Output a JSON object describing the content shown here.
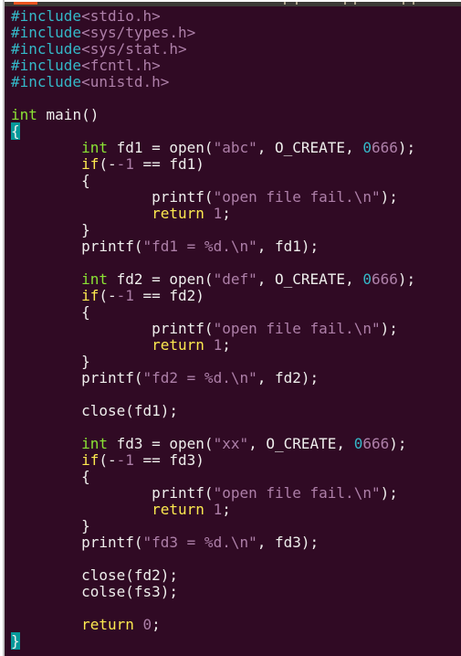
{
  "colors": {
    "background": "#300a24",
    "preprocessor": "#34b8c8",
    "type": "#8ae234",
    "keyword": "#fce94f",
    "string": "#ad7fa8",
    "cursor": "#06989a",
    "tab_accent": "#e95420"
  },
  "editor": {
    "lines": [
      [
        [
          "#include",
          "preproc"
        ],
        [
          "<stdio.h>",
          "include"
        ]
      ],
      [
        [
          "#include",
          "preproc"
        ],
        [
          "<sys/types.h>",
          "include"
        ]
      ],
      [
        [
          "#include",
          "preproc"
        ],
        [
          "<sys/stat.h>",
          "include"
        ]
      ],
      [
        [
          "#include",
          "preproc"
        ],
        [
          "<fcntl.h>",
          "include"
        ]
      ],
      [
        [
          "#include",
          "preproc"
        ],
        [
          "<unistd.h>",
          "include"
        ]
      ],
      [],
      [
        [
          "int",
          "type"
        ],
        [
          " main()",
          "normal"
        ]
      ],
      [
        [
          "{",
          "cursor"
        ]
      ],
      [
        [
          "\t",
          "normal"
        ],
        [
          "int",
          "type"
        ],
        [
          " fd1 = open(",
          "normal"
        ],
        [
          "\"abc\"",
          "string"
        ],
        [
          ", O_CREATE, ",
          "normal"
        ],
        [
          "0",
          "octal"
        ],
        [
          "666",
          "number"
        ],
        [
          ");",
          "normal"
        ]
      ],
      [
        [
          "\t",
          "normal"
        ],
        [
          "if",
          "keyword"
        ],
        [
          "(-",
          "normal"
        ],
        [
          "-1",
          "number"
        ],
        [
          " == fd1)",
          "normal"
        ]
      ],
      [
        [
          "\t{",
          "normal"
        ]
      ],
      [
        [
          "\t\tprintf(",
          "normal"
        ],
        [
          "\"open file fail.\\n\"",
          "string"
        ],
        [
          ");",
          "normal"
        ]
      ],
      [
        [
          "\t\t",
          "normal"
        ],
        [
          "return",
          "keyword"
        ],
        [
          " ",
          "normal"
        ],
        [
          "1",
          "number"
        ],
        [
          ";",
          "normal"
        ]
      ],
      [
        [
          "\t}",
          "normal"
        ]
      ],
      [
        [
          "\tprintf(",
          "normal"
        ],
        [
          "\"fd1 = %d.\\n\"",
          "string"
        ],
        [
          ", fd1);",
          "normal"
        ]
      ],
      [],
      [
        [
          "\t",
          "normal"
        ],
        [
          "int",
          "type"
        ],
        [
          " fd2 = open(",
          "normal"
        ],
        [
          "\"def\"",
          "string"
        ],
        [
          ", O_CREATE, ",
          "normal"
        ],
        [
          "0",
          "octal"
        ],
        [
          "666",
          "number"
        ],
        [
          ");",
          "normal"
        ]
      ],
      [
        [
          "\t",
          "normal"
        ],
        [
          "if",
          "keyword"
        ],
        [
          "(-",
          "normal"
        ],
        [
          "-1",
          "number"
        ],
        [
          " == fd2)",
          "normal"
        ]
      ],
      [
        [
          "\t{",
          "normal"
        ]
      ],
      [
        [
          "\t\tprintf(",
          "normal"
        ],
        [
          "\"open file fail.\\n\"",
          "string"
        ],
        [
          ");",
          "normal"
        ]
      ],
      [
        [
          "\t\t",
          "normal"
        ],
        [
          "return",
          "keyword"
        ],
        [
          " ",
          "normal"
        ],
        [
          "1",
          "number"
        ],
        [
          ";",
          "normal"
        ]
      ],
      [
        [
          "\t}",
          "normal"
        ]
      ],
      [
        [
          "\tprintf(",
          "normal"
        ],
        [
          "\"fd2 = %d.\\n\"",
          "string"
        ],
        [
          ", fd2);",
          "normal"
        ]
      ],
      [],
      [
        [
          "\tclose(fd1);",
          "normal"
        ]
      ],
      [],
      [
        [
          "\t",
          "normal"
        ],
        [
          "int",
          "type"
        ],
        [
          " fd3 = open(",
          "normal"
        ],
        [
          "\"xx\"",
          "string"
        ],
        [
          ", O_CREATE, ",
          "normal"
        ],
        [
          "0",
          "octal"
        ],
        [
          "666",
          "number"
        ],
        [
          ");",
          "normal"
        ]
      ],
      [
        [
          "\t",
          "normal"
        ],
        [
          "if",
          "keyword"
        ],
        [
          "(-",
          "normal"
        ],
        [
          "-1",
          "number"
        ],
        [
          " == fd3)",
          "normal"
        ]
      ],
      [
        [
          "\t{",
          "normal"
        ]
      ],
      [
        [
          "\t\tprintf(",
          "normal"
        ],
        [
          "\"open file fail.\\n\"",
          "string"
        ],
        [
          ");",
          "normal"
        ]
      ],
      [
        [
          "\t\t",
          "normal"
        ],
        [
          "return",
          "keyword"
        ],
        [
          " ",
          "normal"
        ],
        [
          "1",
          "number"
        ],
        [
          ";",
          "normal"
        ]
      ],
      [
        [
          "\t}",
          "normal"
        ]
      ],
      [
        [
          "\tprintf(",
          "normal"
        ],
        [
          "\"fd3 = %d.\\n\"",
          "string"
        ],
        [
          ", fd3);",
          "normal"
        ]
      ],
      [],
      [
        [
          "\tclose(fd2);",
          "normal"
        ]
      ],
      [
        [
          "\tcolse(fs3);",
          "normal"
        ]
      ],
      [],
      [
        [
          "\t",
          "normal"
        ],
        [
          "return",
          "keyword"
        ],
        [
          " ",
          "normal"
        ],
        [
          "0",
          "number"
        ],
        [
          ";",
          "normal"
        ]
      ],
      [
        [
          "}",
          "cursor"
        ]
      ]
    ]
  }
}
